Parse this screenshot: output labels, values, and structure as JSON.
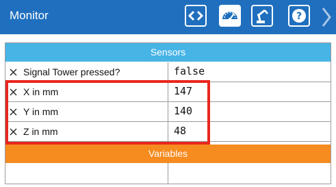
{
  "header": {
    "title": "Monitor",
    "background": "#1f6fbe",
    "buttons": [
      {
        "icon": "code-icon",
        "active": false
      },
      {
        "icon": "gauge-icon",
        "active": true
      },
      {
        "icon": "robot-arm-icon",
        "active": false
      },
      {
        "icon": "help-icon",
        "active": false
      },
      {
        "icon": "chevron-right-icon",
        "active": false
      }
    ]
  },
  "sensors": {
    "title": "Sensors",
    "color": "#47b4e6",
    "rows": [
      {
        "name": "Signal Tower pressed?",
        "value": "false",
        "icon": "close-icon"
      },
      {
        "name": "X in mm",
        "value": "147",
        "icon": "close-icon"
      },
      {
        "name": "Y in mm",
        "value": "140",
        "icon": "close-icon"
      },
      {
        "name": "Z in mm",
        "value": "48",
        "icon": "close-icon"
      }
    ]
  },
  "variables": {
    "title": "Variables",
    "color": "#f68b1f",
    "rows": [
      {
        "name": "",
        "value": ""
      }
    ]
  },
  "highlight_color": "#e8261e"
}
